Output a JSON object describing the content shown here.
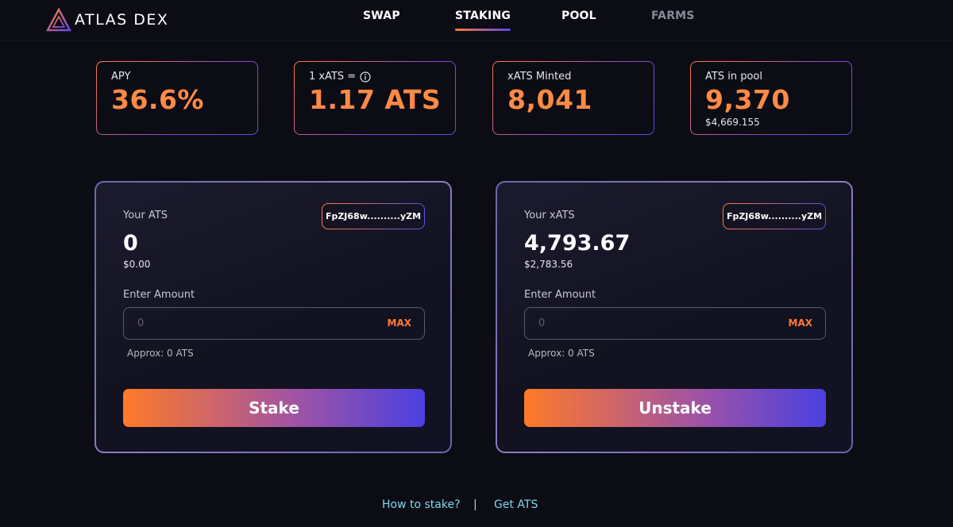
{
  "brand": {
    "name": "ATLAS DEX",
    "accent": "#ff8a45",
    "gradient_start": "#ff7a28",
    "gradient_end": "#4a40e0"
  },
  "nav": {
    "items": [
      {
        "label": "SWAP",
        "active": false
      },
      {
        "label": "STAKING",
        "active": true
      },
      {
        "label": "POOL",
        "active": false
      },
      {
        "label": "FARMS",
        "active": false
      }
    ]
  },
  "stats": [
    {
      "label": "APY",
      "value": "36.6%"
    },
    {
      "label": "1 xATS =",
      "value": "1.17 ATS",
      "icon": "info-icon"
    },
    {
      "label": "xATS Minted",
      "value": "8,041"
    },
    {
      "label": "ATS in pool",
      "value": "9,370",
      "sub": "$4,669.155"
    }
  ],
  "stake_panel": {
    "label": "Your ATS",
    "address": "FpZJ68w..........yZM",
    "balance": "0",
    "balance_usd": "$0.00",
    "amount_label": "Enter Amount",
    "input_placeholder": "0",
    "max_label": "MAX",
    "approx": "Approx: 0 ATS",
    "button_label": "Stake"
  },
  "unstake_panel": {
    "label": "Your xATS",
    "address": "FpZJ68w..........yZM",
    "balance": "4,793.67",
    "balance_usd": "$2,783.56",
    "amount_label": "Enter Amount",
    "input_placeholder": "0",
    "max_label": "MAX",
    "approx": "Approx: 0 ATS",
    "button_label": "Unstake"
  },
  "footer": {
    "how_to_stake": "How to stake?",
    "separator": "|",
    "get_ats": "Get ATS"
  }
}
